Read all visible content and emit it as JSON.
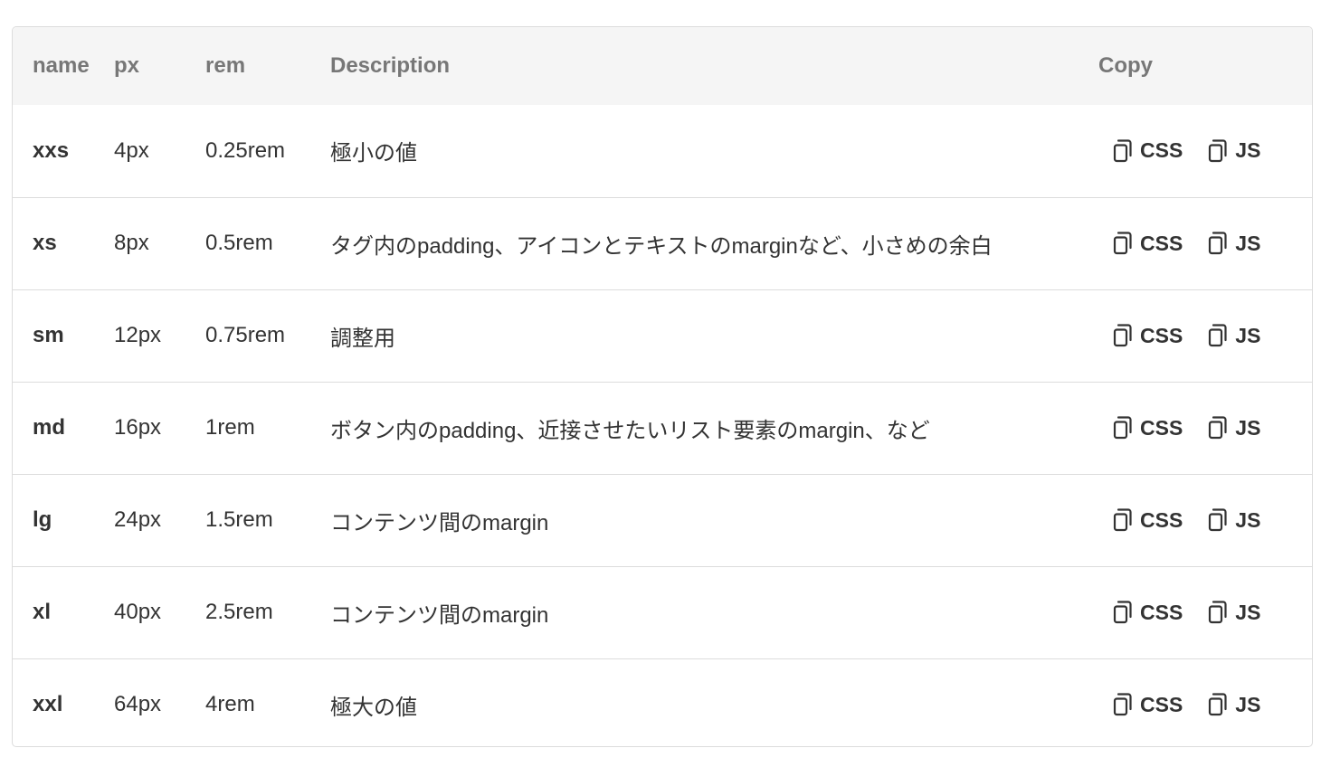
{
  "header": {
    "name": "name",
    "px": "px",
    "rem": "rem",
    "description": "Description",
    "copy": "Copy"
  },
  "copy_labels": {
    "css": "CSS",
    "js": "JS"
  },
  "rows": [
    {
      "name": "xxs",
      "px": "4px",
      "rem": "0.25rem",
      "description": "極小の値"
    },
    {
      "name": "xs",
      "px": "8px",
      "rem": "0.5rem",
      "description": "タグ内のpadding、アイコンとテキストのmarginなど、小さめの余白"
    },
    {
      "name": "sm",
      "px": "12px",
      "rem": "0.75rem",
      "description": "調整用"
    },
    {
      "name": "md",
      "px": "16px",
      "rem": "1rem",
      "description": "ボタン内のpadding、近接させたいリスト要素のmargin、など"
    },
    {
      "name": "lg",
      "px": "24px",
      "rem": "1.5rem",
      "description": "コンテンツ間のmargin"
    },
    {
      "name": "xl",
      "px": "40px",
      "rem": "2.5rem",
      "description": "コンテンツ間のmargin"
    },
    {
      "name": "xxl",
      "px": "64px",
      "rem": "4rem",
      "description": "極大の値"
    }
  ]
}
